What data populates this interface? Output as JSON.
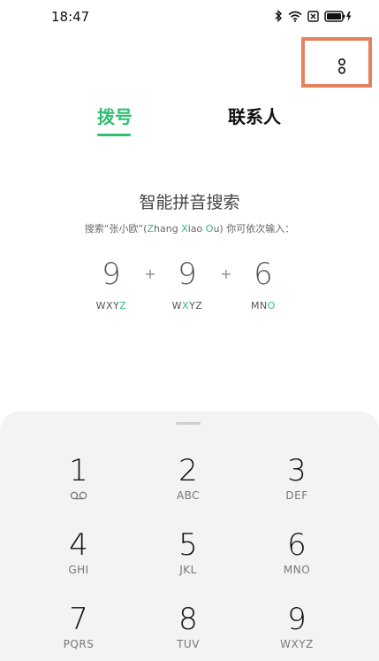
{
  "status_bar": {
    "time": "18:47",
    "icons": [
      "bluetooth-icon",
      "wifi-icon",
      "sim-x-icon",
      "battery-charging-icon"
    ]
  },
  "header": {
    "menu_icon": "more-vertical-icon",
    "highlight_color": "#e4825c"
  },
  "tabs": [
    {
      "label": "拨号",
      "active": true
    },
    {
      "label": "联系人",
      "active": false
    }
  ],
  "hint": {
    "title": "智能拼音搜索",
    "subtitle": {
      "p1": "搜索“张小欧”(",
      "z1": "Z",
      "z2": "hang ",
      "x1": "X",
      "x2": "iao ",
      "o1": "O",
      "o2": "u",
      "p2": ") 你可依次输入："
    },
    "combo": [
      {
        "digit": "9",
        "letters_pre": "WXY",
        "letters_hl": "Z",
        "letters_post": ""
      },
      {
        "digit": "9",
        "letters_pre": "W",
        "letters_hl": "X",
        "letters_post": "YZ"
      },
      {
        "digit": "6",
        "letters_pre": "MN",
        "letters_hl": "O",
        "letters_post": ""
      }
    ],
    "plus": "+"
  },
  "keypad": {
    "keys": [
      {
        "digit": "1",
        "letters": "",
        "icon": "voicemail-icon"
      },
      {
        "digit": "2",
        "letters": "ABC"
      },
      {
        "digit": "3",
        "letters": "DEF"
      },
      {
        "digit": "4",
        "letters": "GHI"
      },
      {
        "digit": "5",
        "letters": "JKL"
      },
      {
        "digit": "6",
        "letters": "MNO"
      },
      {
        "digit": "7",
        "letters": "PQRS"
      },
      {
        "digit": "8",
        "letters": "TUV"
      },
      {
        "digit": "9",
        "letters": "WXYZ"
      }
    ]
  },
  "colors": {
    "accent": "#2fbf71",
    "keypad_bg": "#f3f3f3"
  }
}
